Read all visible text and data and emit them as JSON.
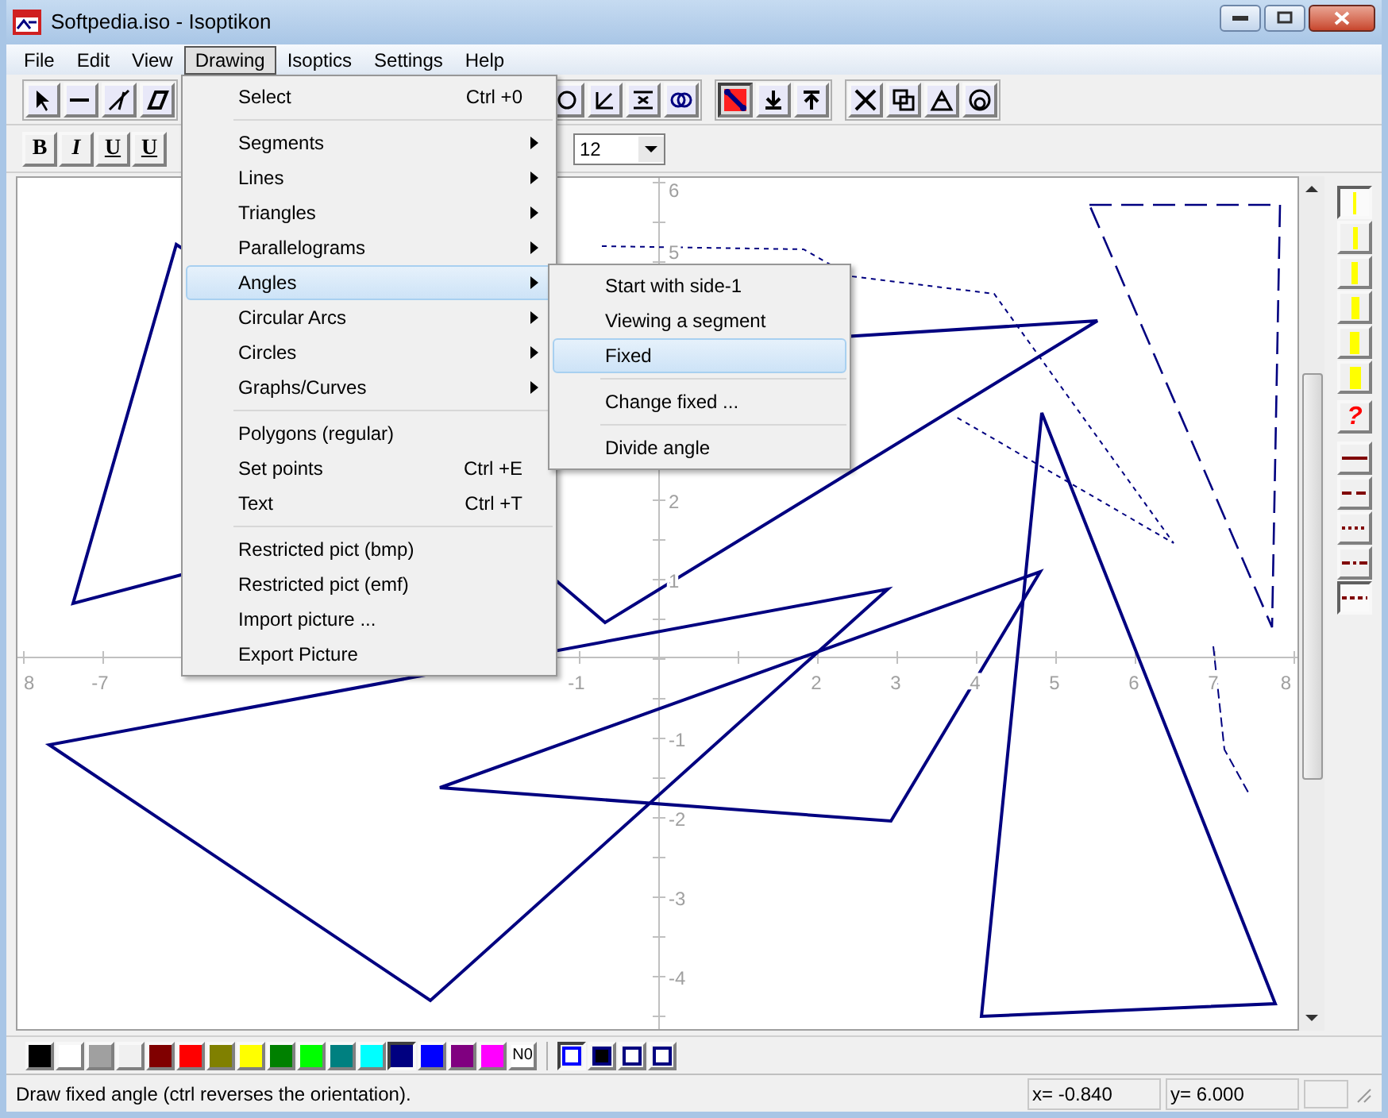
{
  "window": {
    "title": "Softpedia.iso - Isoptikon"
  },
  "menubar": [
    {
      "label": "File",
      "selected": false
    },
    {
      "label": "Edit",
      "selected": false
    },
    {
      "label": "View",
      "selected": false
    },
    {
      "label": "Drawing",
      "selected": true
    },
    {
      "label": "Isoptics",
      "selected": false
    },
    {
      "label": "Settings",
      "selected": false
    },
    {
      "label": "Help",
      "selected": false
    }
  ],
  "main_toolbar": {
    "buttons": [
      {
        "selected": false
      },
      {
        "selected": false
      },
      {
        "selected": false
      },
      {
        "selected": false
      },
      {
        "selected": false
      },
      {
        "selected": false
      },
      {
        "selected": false
      },
      {
        "selected": false
      },
      {
        "selected": true
      },
      {
        "selected": false
      },
      {
        "selected": false
      },
      {
        "selected": false
      },
      {
        "selected": false
      },
      {
        "selected": false
      },
      {
        "selected": false
      }
    ]
  },
  "format_toolbar": {
    "buttons": [
      {
        "kind": "bold",
        "label": "B"
      },
      {
        "kind": "italic",
        "label": "I"
      },
      {
        "kind": "underline",
        "label": "U"
      },
      {
        "kind": "strike",
        "label": "U"
      }
    ],
    "font_size": "12"
  },
  "drawing_menu": [
    {
      "kind": "item",
      "label": "Select",
      "shortcut": "Ctrl +0",
      "submenu": false,
      "highlighted": false
    },
    {
      "kind": "separator"
    },
    {
      "kind": "item",
      "label": "Segments",
      "submenu": true,
      "highlighted": false
    },
    {
      "kind": "item",
      "label": "Lines",
      "submenu": true,
      "highlighted": false
    },
    {
      "kind": "item",
      "label": "Triangles",
      "submenu": true,
      "highlighted": false
    },
    {
      "kind": "item",
      "label": "Parallelograms",
      "submenu": true,
      "highlighted": false
    },
    {
      "kind": "item",
      "label": "Angles",
      "submenu": true,
      "highlighted": true
    },
    {
      "kind": "item",
      "label": "Circular Arcs",
      "submenu": true,
      "highlighted": false
    },
    {
      "kind": "item",
      "label": "Circles",
      "submenu": true,
      "highlighted": false
    },
    {
      "kind": "item",
      "label": "Graphs/Curves",
      "submenu": true,
      "highlighted": false
    },
    {
      "kind": "separator"
    },
    {
      "kind": "item",
      "label": "Polygons (regular)",
      "submenu": false,
      "highlighted": false
    },
    {
      "kind": "item",
      "label": "Set points",
      "shortcut": "Ctrl +E",
      "submenu": false,
      "highlighted": false
    },
    {
      "kind": "item",
      "label": "Text",
      "shortcut": "Ctrl +T",
      "submenu": false,
      "highlighted": false
    },
    {
      "kind": "separator"
    },
    {
      "kind": "item",
      "label": "Restricted pict (bmp)",
      "submenu": false,
      "highlighted": false
    },
    {
      "kind": "item",
      "label": "Restricted pict (emf)",
      "submenu": false,
      "highlighted": false
    },
    {
      "kind": "item",
      "label": "Import picture ...",
      "submenu": false,
      "highlighted": false
    },
    {
      "kind": "item",
      "label": "Export Picture",
      "submenu": false,
      "highlighted": false
    }
  ],
  "angles_submenu": [
    {
      "kind": "item",
      "label": "Start with side-1",
      "highlighted": false
    },
    {
      "kind": "item",
      "label": "Viewing a segment",
      "highlighted": false
    },
    {
      "kind": "item",
      "label": "Fixed",
      "highlighted": true
    },
    {
      "kind": "separator"
    },
    {
      "kind": "item",
      "label": "Change fixed ...",
      "highlighted": false
    },
    {
      "kind": "separator"
    },
    {
      "kind": "item",
      "label": "Divide angle",
      "highlighted": false
    }
  ],
  "canvas": {
    "x_axis_labels": [
      "8",
      "-7",
      "-1",
      "2",
      "3",
      "4",
      "5",
      "6",
      "7",
      "8"
    ],
    "y_axis_labels": [
      "6",
      "5",
      "2",
      "1",
      "-1",
      "-2",
      "-3",
      "-4"
    ]
  },
  "line_widths": [
    {
      "selected": true
    },
    {
      "selected": false
    },
    {
      "selected": false
    },
    {
      "selected": false
    },
    {
      "selected": false
    },
    {
      "selected": false
    }
  ],
  "help_button": {
    "label": "?"
  },
  "line_styles": [
    {
      "selected": false
    },
    {
      "selected": false
    },
    {
      "selected": false
    },
    {
      "selected": false
    },
    {
      "selected": true
    }
  ],
  "palette": [
    {
      "color": "#000000",
      "selected": false
    },
    {
      "color": "#ffffff",
      "selected": false
    },
    {
      "color": "#a0a0a0",
      "selected": false
    },
    {
      "color": "#f0f0f0",
      "selected": false
    },
    {
      "color": "#800000",
      "selected": false
    },
    {
      "color": "#ff0000",
      "selected": false
    },
    {
      "color": "#808000",
      "selected": false
    },
    {
      "color": "#ffff00",
      "selected": false
    },
    {
      "color": "#008000",
      "selected": false
    },
    {
      "color": "#00ff00",
      "selected": false
    },
    {
      "color": "#008080",
      "selected": false
    },
    {
      "color": "#00ffff",
      "selected": false
    },
    {
      "color": "#000080",
      "selected": true
    },
    {
      "color": "#0000ff",
      "selected": false
    },
    {
      "color": "#800080",
      "selected": false
    },
    {
      "color": "#ff00ff",
      "selected": false
    }
  ],
  "no_color_button": {
    "label": "N0"
  },
  "fill_tools": [
    {
      "selected": true
    },
    {
      "selected": false
    },
    {
      "selected": false
    },
    {
      "selected": false
    }
  ],
  "status_bar": {
    "message": "Draw fixed angle (ctrl reverses the orientation).",
    "x": "x= -0.840",
    "y": "y= 6.000"
  }
}
